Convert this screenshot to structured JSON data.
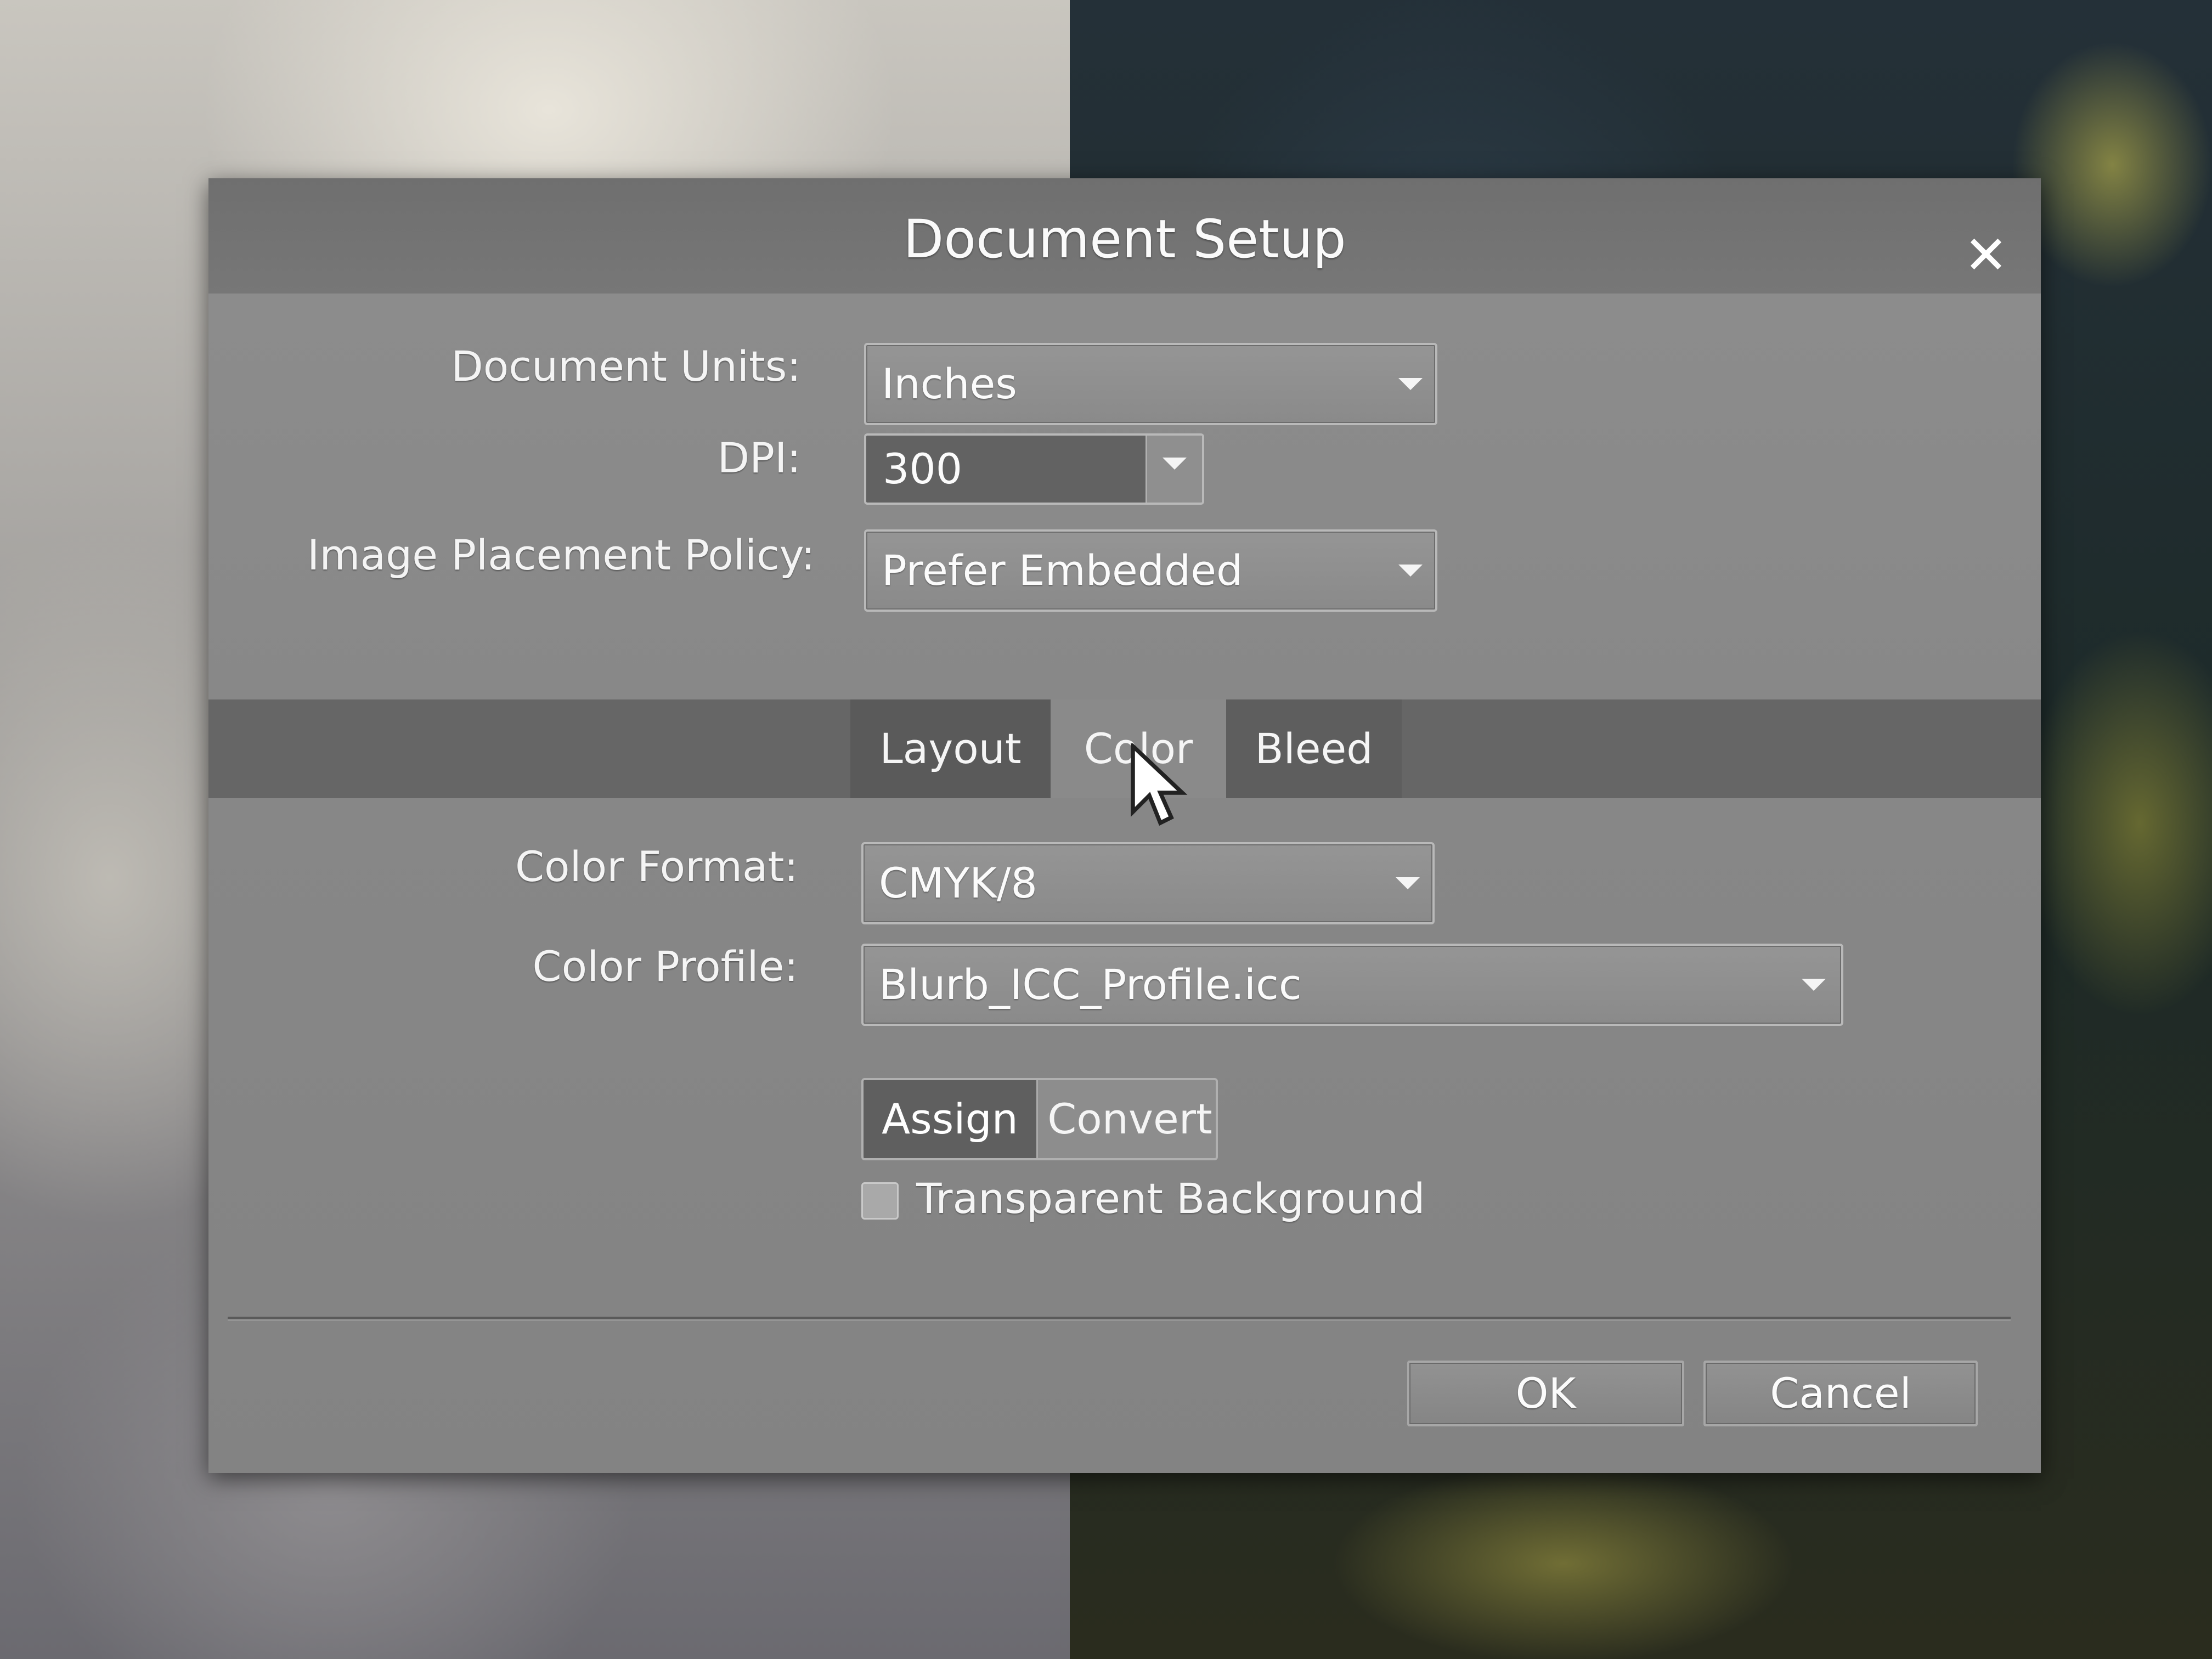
{
  "dialog": {
    "title": "Document Setup",
    "close_icon": "close-icon"
  },
  "fields": {
    "document_units": {
      "label": "Document Units:",
      "value": "Inches"
    },
    "dpi": {
      "label": "DPI:",
      "value": "300"
    },
    "image_placement_policy": {
      "label": "Image Placement Policy:",
      "value": "Prefer Embedded"
    }
  },
  "tabs": [
    {
      "label": "Layout",
      "selected": false
    },
    {
      "label": "Color",
      "selected": true
    },
    {
      "label": "Bleed",
      "selected": false
    }
  ],
  "color_tab": {
    "color_format": {
      "label": "Color Format:",
      "value": "CMYK/8"
    },
    "color_profile": {
      "label": "Color Profile:",
      "value": "Blurb_ICC_Profile.icc"
    },
    "profile_mode": {
      "assign_label": "Assign",
      "convert_label": "Convert",
      "selected": "Assign"
    },
    "transparent_background": {
      "label": "Transparent Background",
      "checked": false
    }
  },
  "buttons": {
    "ok_label": "OK",
    "cancel_label": "Cancel"
  },
  "colors": {
    "dialog_bg": "#8a8a8a",
    "tabbar_bg": "#666666",
    "selected_tab_bg": "#8a8a8a",
    "text": "#f4f4f4"
  }
}
